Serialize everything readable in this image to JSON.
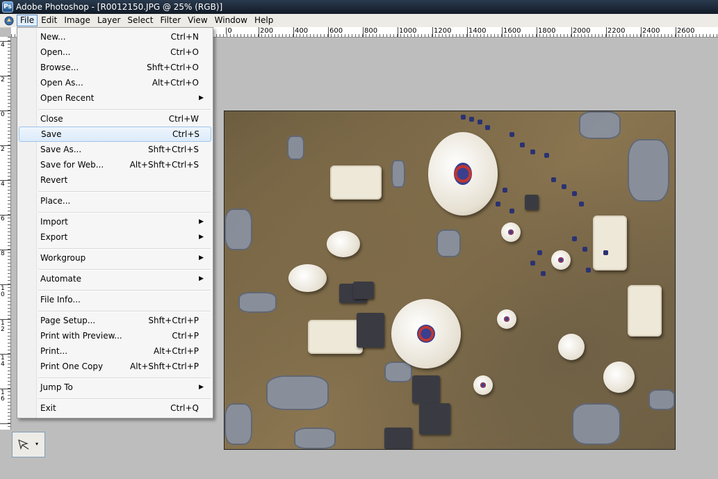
{
  "window": {
    "title": "Adobe Photoshop - [R0012150.JPG @ 25% (RGB)]"
  },
  "menubar": {
    "items": [
      "File",
      "Edit",
      "Image",
      "Layer",
      "Select",
      "Filter",
      "View",
      "Window",
      "Help"
    ],
    "active": "File"
  },
  "ruler": {
    "h_labels": [
      "|0",
      "200",
      "400",
      "600",
      "800",
      "1000",
      "1200",
      "1400",
      "1600",
      "1800",
      "2000",
      "2200",
      "2400",
      "2600"
    ],
    "v_labels": [
      "4",
      "2",
      "0",
      "2",
      "4",
      "6",
      "8",
      "1 0",
      "1 2",
      "1 4",
      "1 6",
      "1 8"
    ]
  },
  "file_menu": {
    "items": [
      {
        "label": "New...",
        "shortcut": "Ctrl+N"
      },
      {
        "label": "Open...",
        "shortcut": "Ctrl+O"
      },
      {
        "label": "Browse...",
        "shortcut": "Shft+Ctrl+O"
      },
      {
        "label": "Open As...",
        "shortcut": "Alt+Ctrl+O"
      },
      {
        "label": "Open Recent",
        "shortcut": "",
        "submenu": true
      },
      {
        "label": "Close",
        "shortcut": "Ctrl+W"
      },
      {
        "label": "Save",
        "shortcut": "Ctrl+S",
        "highlighted": true
      },
      {
        "label": "Save As...",
        "shortcut": "Shft+Ctrl+S"
      },
      {
        "label": "Save for Web...",
        "shortcut": "Alt+Shft+Ctrl+S"
      },
      {
        "label": "Revert",
        "shortcut": ""
      },
      {
        "label": "Place...",
        "shortcut": ""
      },
      {
        "label": "Import",
        "shortcut": "",
        "submenu": true
      },
      {
        "label": "Export",
        "shortcut": "",
        "submenu": true
      },
      {
        "label": "Workgroup",
        "shortcut": "",
        "submenu": true
      },
      {
        "label": "Automate",
        "shortcut": "",
        "submenu": true
      },
      {
        "label": "File Info...",
        "shortcut": ""
      },
      {
        "label": "Page Setup...",
        "shortcut": "Shft+Ctrl+P"
      },
      {
        "label": "Print with Preview...",
        "shortcut": "Ctrl+P"
      },
      {
        "label": "Print...",
        "shortcut": "Alt+Ctrl+P"
      },
      {
        "label": "Print One Copy",
        "shortcut": "Alt+Shft+Ctrl+P"
      },
      {
        "label": "Jump To",
        "shortcut": "",
        "submenu": true
      },
      {
        "label": "Exit",
        "shortcut": "Ctrl+Q"
      }
    ]
  },
  "toolpreset": {
    "icon": "brush-icon",
    "dropdown": "▾"
  },
  "colors": {
    "workspace": "#bdbdbd",
    "highlight": "#dcebfb",
    "titlebar": "#1b2633"
  }
}
